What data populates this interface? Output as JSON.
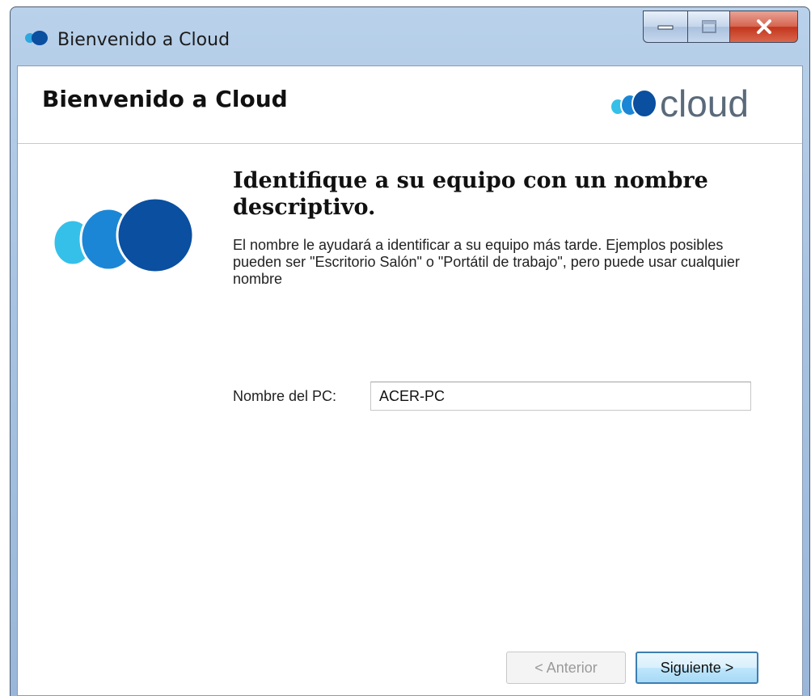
{
  "window": {
    "title": "Bienvenido a Cloud",
    "controls": {
      "minimize_icon": "minimize-icon",
      "maximize_icon": "maximize-icon",
      "close_icon": "close-icon"
    }
  },
  "header": {
    "title": "Bienvenido a Cloud",
    "logo_text": "cloud"
  },
  "main": {
    "headline": "Identifique a su equipo con un nombre descriptivo.",
    "description": "El nombre le ayudará a identificar a su equipo más tarde. Ejemplos posibles pueden ser \"Escritorio Salón\" o \"Portátil de trabajo\", pero puede usar cualquier nombre",
    "pc_name_label": "Nombre del PC:",
    "pc_name_value": "ACER-PC"
  },
  "buttons": {
    "back": "< Anterior",
    "next": "Siguiente >"
  },
  "colors": {
    "brand_dark_blue": "#0a4fa0",
    "brand_mid_blue": "#1c86d6",
    "brand_light_blue": "#35c0ea",
    "logo_text": "#5a6a7a"
  }
}
